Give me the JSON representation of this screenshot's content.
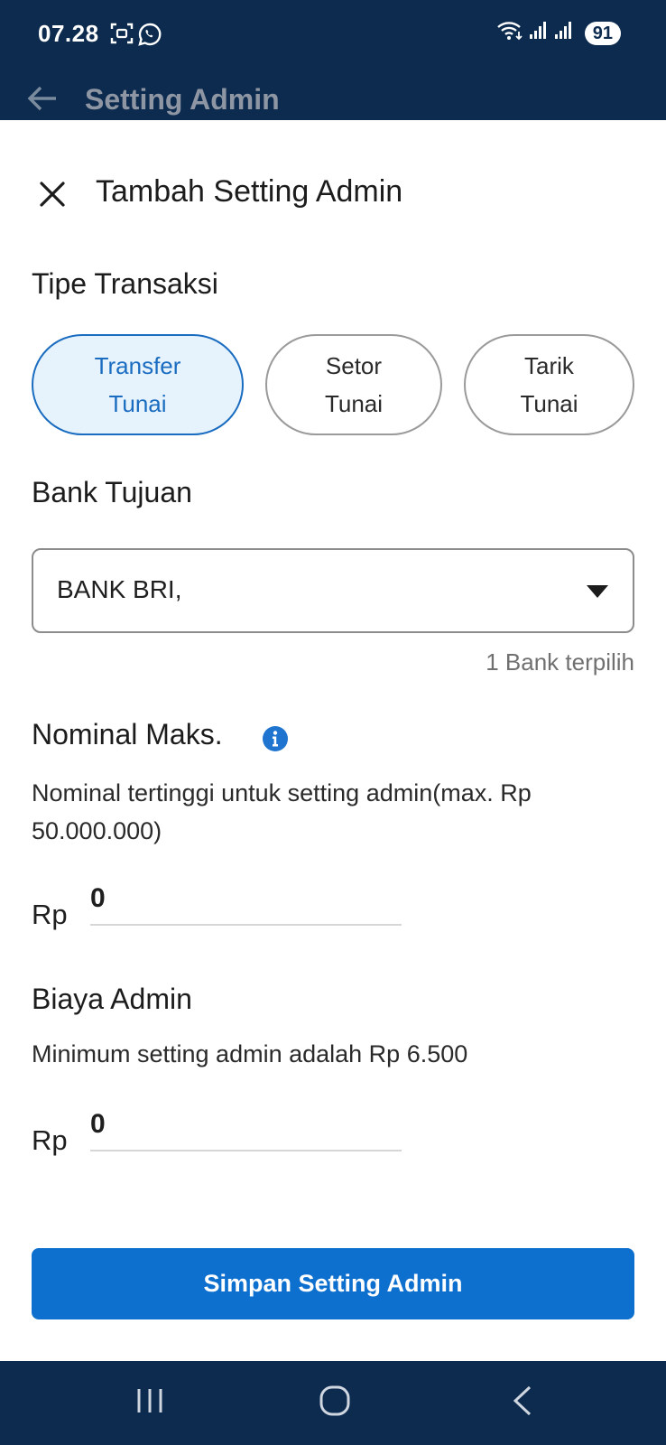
{
  "status_bar": {
    "time": "07.28",
    "battery": "91",
    "left_icons": [
      "screenshot-icon",
      "whatsapp-icon"
    ],
    "right_icons": [
      "wifi-icon",
      "signal-icon",
      "signal-icon",
      "battery-icon"
    ]
  },
  "appbar": {
    "title": "Setting Admin",
    "back_icon": "arrow-left-icon"
  },
  "sheet": {
    "title": "Tambah Setting Admin",
    "close_icon": "close-icon"
  },
  "transaction_type": {
    "label": "Tipe Transaksi",
    "options": [
      {
        "line1": "Transfer",
        "line2": "Tunai",
        "selected": true
      },
      {
        "line1": "Setor",
        "line2": "Tunai",
        "selected": false
      },
      {
        "line1": "Tarik",
        "line2": "Tunai",
        "selected": false
      }
    ]
  },
  "bank": {
    "label": "Bank Tujuan",
    "value": "BANK BRI,",
    "helper": "1 Bank terpilih",
    "caret_icon": "caret-down-icon"
  },
  "max_nominal": {
    "label": "Nominal Maks.",
    "info_icon": "info-icon",
    "description": "Nominal tertinggi untuk setting admin(max. Rp 50.000.000)",
    "currency": "Rp",
    "value": "0"
  },
  "admin_fee": {
    "label": "Biaya Admin",
    "description": "Minimum setting admin adalah Rp 6.500",
    "currency": "Rp",
    "value": "0"
  },
  "actions": {
    "save_label": "Simpan Setting Admin"
  },
  "nav": {
    "icons": [
      "recent-apps-icon",
      "home-icon",
      "back-icon"
    ]
  },
  "colors": {
    "primary": "#0d6fce",
    "header": "#0c2b4f",
    "chip_selected_bg": "#e6f3fd",
    "chip_selected_text": "#1a6cc0"
  }
}
